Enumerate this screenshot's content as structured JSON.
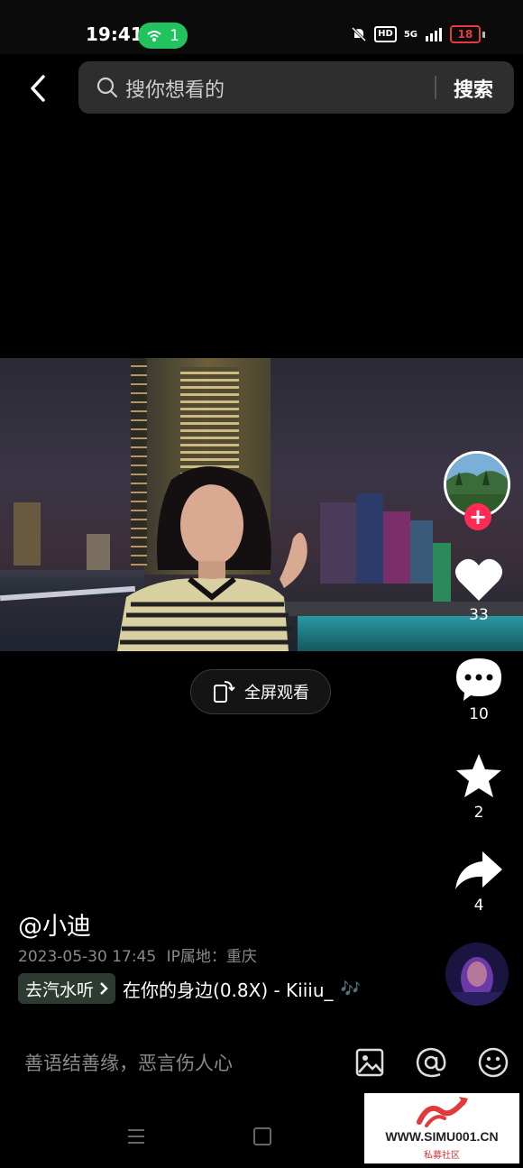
{
  "status_bar": {
    "time": "19:41",
    "hotspot_count": "1",
    "hd_label": "HD",
    "network_label": "5G",
    "battery": "18"
  },
  "header": {
    "search_placeholder": "搜你想看的",
    "search_button": "搜索"
  },
  "video": {
    "fullscreen_label": "全屏观看"
  },
  "actions": {
    "likes": "33",
    "comments": "10",
    "favorites": "2",
    "shares": "4",
    "follow_plus": "+"
  },
  "caption": {
    "author": "@小迪",
    "datetime": "2023-05-30 17:45",
    "location": "IP属地：重庆",
    "music_chip": "去汽水听",
    "music_title": "在你的身边(0.8X) - Kiiiu_",
    "music_note": "🎶"
  },
  "comment_bar": {
    "placeholder": "善语结善缘，恶言伤人心"
  },
  "watermark": {
    "text": "WWW.SIMU001.CN",
    "sub": "私募社区"
  },
  "colors": {
    "accent": "#fe2c55",
    "hotspot": "#22c35e",
    "battery": "#e83a3a"
  }
}
